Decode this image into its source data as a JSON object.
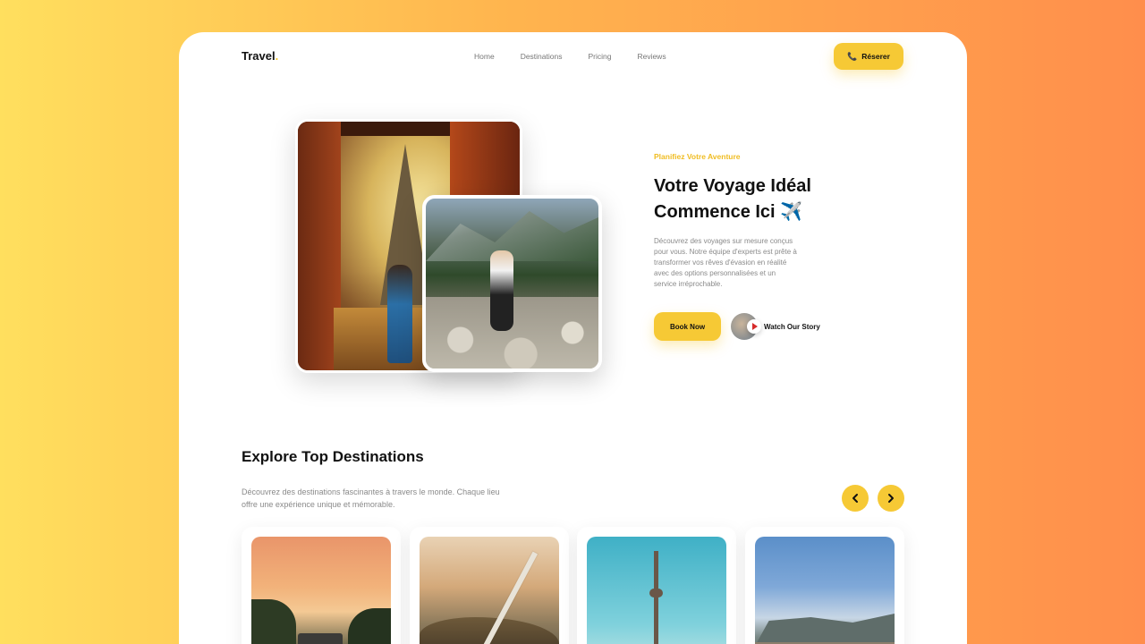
{
  "header": {
    "logo_text": "Travel",
    "logo_dot": ".",
    "nav": [
      "Home",
      "Destinations",
      "Pricing",
      "Reviews"
    ],
    "cta_label": "Réserer",
    "cta_icon": "phone-icon"
  },
  "hero": {
    "eyebrow": "Planifiez Votre Aventure",
    "title_line1": "Votre Voyage Idéal",
    "title_line2": "Commence Ici ✈️",
    "description": "Découvrez des voyages sur mesure conçus pour vous. Notre équipe d'experts est prête à transformer vos rêves d'évasion en réalité avec des options personnalisées et un service irréprochable.",
    "book_label": "Book Now",
    "watch_label": "Watch Our Story"
  },
  "explore": {
    "title": "Explore Top Destinations",
    "description": "Découvrez des destinations fascinantes à travers le monde. Chaque lieu offre une expérience unique et mémorable."
  },
  "colors": {
    "accent": "#f6c935",
    "eyebrow": "#f0bd23",
    "background_start": "#ffdf5e",
    "background_end": "#ff8e4c"
  }
}
